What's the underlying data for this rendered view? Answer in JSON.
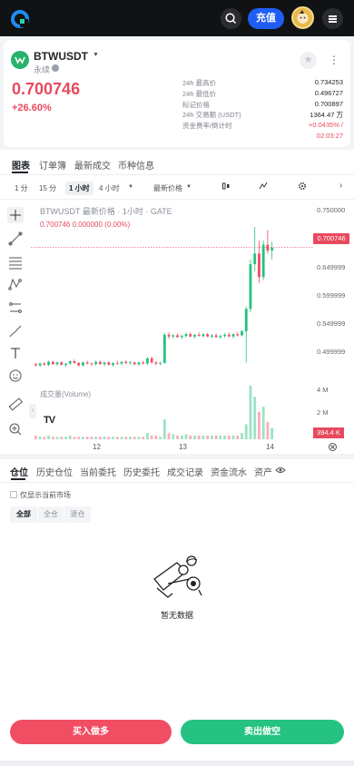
{
  "topbar": {
    "deposit_label": "充值",
    "icons": [
      "logo-icon",
      "search-icon",
      "avatar",
      "menu-icon"
    ]
  },
  "pair": {
    "symbol": "BTWUSDT",
    "type": "永续",
    "price": "0.700746",
    "change_pct": "+26.60%",
    "stats": [
      {
        "label": "24h 最高价",
        "value": "0.734253"
      },
      {
        "label": "24h 最低价",
        "value": "0.496727"
      },
      {
        "label": "标记价格",
        "value": "0.700897"
      },
      {
        "label": "24h 交易额 (USDT)",
        "value": "1364.47 万"
      },
      {
        "label": "资金费率/倒计时",
        "value": "+0.0435% /"
      }
    ],
    "countdown": "02:03:27"
  },
  "tabs": [
    "图表",
    "订单簿",
    "最新成交",
    "币种信息"
  ],
  "timeframes": {
    "items": [
      "1 分",
      "15 分",
      "1 小时",
      "4 小时"
    ],
    "active": "1 小时",
    "price_type": "最新价格"
  },
  "chart_data": {
    "type": "candlestick",
    "title": "BTWUSDT 最新价格 · 1小时 · GATE",
    "subtitle": "0.700746  0.000000 (0.00%)",
    "x_ticks": [
      "12",
      "13",
      "14"
    ],
    "y_ticks": [
      "0.750000",
      "0.649999",
      "0.599999",
      "0.549999",
      "0.499999"
    ],
    "ylim": [
      0.47,
      0.76
    ],
    "last_price": "0.700746",
    "volume_label": "成交量(Volume)",
    "volume_ticks": [
      "4 M",
      "2 M"
    ],
    "volume_last": "394.4 K",
    "candles": [
      [
        0.502,
        0.504,
        0.498,
        0.5
      ],
      [
        0.5,
        0.505,
        0.497,
        0.503
      ],
      [
        0.503,
        0.506,
        0.5,
        0.501
      ],
      [
        0.501,
        0.508,
        0.499,
        0.506
      ],
      [
        0.506,
        0.508,
        0.501,
        0.502
      ],
      [
        0.502,
        0.506,
        0.499,
        0.505
      ],
      [
        0.505,
        0.507,
        0.5,
        0.501
      ],
      [
        0.501,
        0.504,
        0.497,
        0.503
      ],
      [
        0.503,
        0.509,
        0.501,
        0.507
      ],
      [
        0.507,
        0.51,
        0.503,
        0.504
      ],
      [
        0.504,
        0.506,
        0.498,
        0.5
      ],
      [
        0.5,
        0.506,
        0.498,
        0.505
      ],
      [
        0.505,
        0.508,
        0.502,
        0.503
      ],
      [
        0.503,
        0.505,
        0.499,
        0.502
      ],
      [
        0.502,
        0.508,
        0.5,
        0.506
      ],
      [
        0.506,
        0.508,
        0.501,
        0.502
      ],
      [
        0.502,
        0.506,
        0.499,
        0.505
      ],
      [
        0.505,
        0.507,
        0.5,
        0.501
      ],
      [
        0.501,
        0.505,
        0.498,
        0.504
      ],
      [
        0.504,
        0.508,
        0.501,
        0.503
      ],
      [
        0.503,
        0.507,
        0.5,
        0.506
      ],
      [
        0.506,
        0.509,
        0.502,
        0.504
      ],
      [
        0.504,
        0.507,
        0.501,
        0.505
      ],
      [
        0.505,
        0.506,
        0.5,
        0.502
      ],
      [
        0.502,
        0.506,
        0.499,
        0.505
      ],
      [
        0.505,
        0.508,
        0.502,
        0.503
      ],
      [
        0.503,
        0.514,
        0.501,
        0.512
      ],
      [
        0.512,
        0.515,
        0.503,
        0.505
      ],
      [
        0.505,
        0.507,
        0.5,
        0.503
      ],
      [
        0.503,
        0.506,
        0.5,
        0.504
      ],
      [
        0.504,
        0.555,
        0.503,
        0.552
      ],
      [
        0.552,
        0.556,
        0.545,
        0.549
      ],
      [
        0.549,
        0.553,
        0.546,
        0.551
      ],
      [
        0.551,
        0.554,
        0.547,
        0.548
      ],
      [
        0.548,
        0.552,
        0.545,
        0.55
      ],
      [
        0.55,
        0.556,
        0.547,
        0.553
      ],
      [
        0.553,
        0.556,
        0.548,
        0.549
      ],
      [
        0.549,
        0.553,
        0.546,
        0.552
      ],
      [
        0.552,
        0.556,
        0.549,
        0.55
      ],
      [
        0.55,
        0.554,
        0.547,
        0.553
      ],
      [
        0.553,
        0.555,
        0.548,
        0.549
      ],
      [
        0.549,
        0.553,
        0.546,
        0.551
      ],
      [
        0.551,
        0.554,
        0.547,
        0.548
      ],
      [
        0.548,
        0.552,
        0.545,
        0.55
      ],
      [
        0.55,
        0.555,
        0.547,
        0.552
      ],
      [
        0.552,
        0.556,
        0.548,
        0.549
      ],
      [
        0.549,
        0.554,
        0.546,
        0.553
      ],
      [
        0.553,
        0.557,
        0.549,
        0.551
      ],
      [
        0.551,
        0.56,
        0.549,
        0.558
      ],
      [
        0.558,
        0.6,
        0.505,
        0.596
      ],
      [
        0.596,
        0.68,
        0.59,
        0.672
      ],
      [
        0.672,
        0.735,
        0.66,
        0.69
      ],
      [
        0.69,
        0.712,
        0.64,
        0.65
      ],
      [
        0.65,
        0.712,
        0.645,
        0.705
      ],
      [
        0.705,
        0.73,
        0.69,
        0.695
      ],
      [
        0.695,
        0.71,
        0.68,
        0.7
      ]
    ],
    "volumes": [
      0.3,
      0.2,
      0.2,
      0.3,
      0.2,
      0.2,
      0.2,
      0.2,
      0.3,
      0.2,
      0.2,
      0.2,
      0.2,
      0.2,
      0.2,
      0.2,
      0.2,
      0.2,
      0.2,
      0.2,
      0.2,
      0.2,
      0.2,
      0.2,
      0.2,
      0.2,
      0.5,
      0.3,
      0.3,
      0.2,
      1.6,
      0.5,
      0.4,
      0.3,
      0.3,
      0.4,
      0.3,
      0.3,
      0.3,
      0.3,
      0.3,
      0.3,
      0.3,
      0.3,
      0.3,
      0.3,
      0.3,
      0.3,
      0.5,
      1.2,
      4.3,
      3.4,
      2.2,
      2.6,
      1.4,
      0.9
    ],
    "vol_max": 4.5
  },
  "bottom_tabs": [
    "仓位",
    "历史仓位",
    "当前委托",
    "历史委托",
    "成交记录",
    "资金流水",
    "资产"
  ],
  "filter": {
    "checkbox_label": "仅显示当前市场",
    "pills": [
      "全部",
      "全仓",
      "逐仓"
    ]
  },
  "empty_text": "暂无数据",
  "actions": {
    "buy_label": "买入做多",
    "sell_label": "卖出做空"
  },
  "colors": {
    "up": "#26c281",
    "down": "#f24e63",
    "accent": "#1f5ef5"
  }
}
